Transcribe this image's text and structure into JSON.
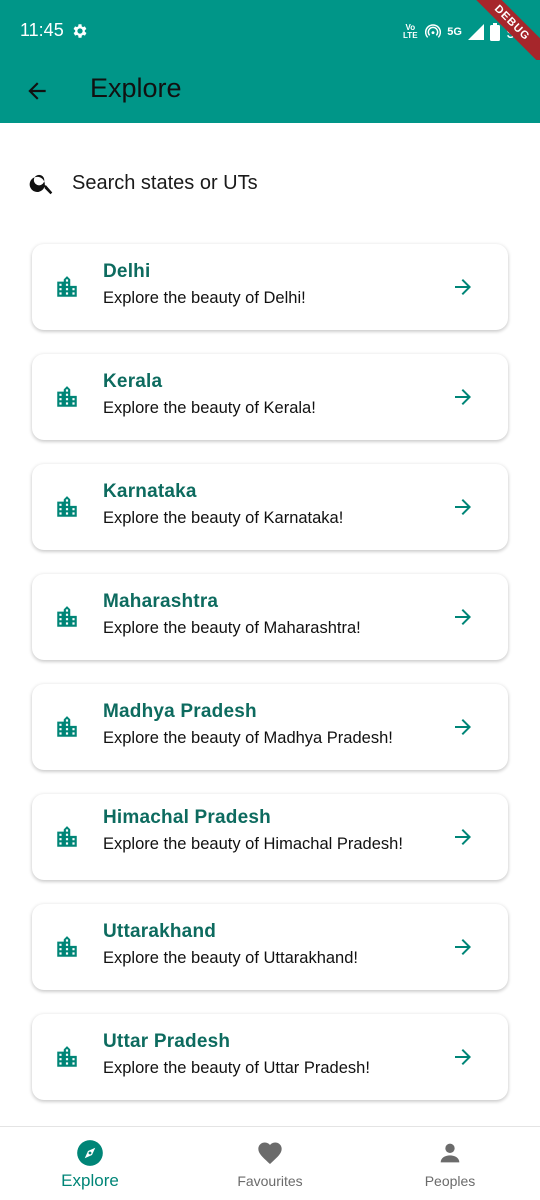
{
  "status_bar": {
    "time": "11:45",
    "network": "5G",
    "volte": "Vo LTE",
    "battery": "93"
  },
  "debug_banner": "DEBUG",
  "app_bar": {
    "title": "Explore"
  },
  "search": {
    "placeholder": "Search states or UTs"
  },
  "places": [
    {
      "name": "Delhi",
      "subtitle": "Explore the beauty of Delhi!"
    },
    {
      "name": "Kerala",
      "subtitle": "Explore the beauty of Kerala!"
    },
    {
      "name": "Karnataka",
      "subtitle": "Explore the beauty of Karnataka!"
    },
    {
      "name": "Maharashtra",
      "subtitle": "Explore the beauty of Maharashtra!"
    },
    {
      "name": "Madhya Pradesh",
      "subtitle": "Explore the beauty of Madhya Pradesh!"
    },
    {
      "name": "Himachal Pradesh",
      "subtitle": "Explore the beauty of Himachal Pradesh!"
    },
    {
      "name": "Uttarakhand",
      "subtitle": "Explore the beauty of Uttarakhand!"
    },
    {
      "name": "Uttar Pradesh",
      "subtitle": "Explore the beauty of Uttar Pradesh!"
    }
  ],
  "bottom_nav": [
    {
      "label": "Explore",
      "icon": "compass-icon",
      "active": true
    },
    {
      "label": "Favourites",
      "icon": "heart-icon",
      "active": false
    },
    {
      "label": "Peoples",
      "icon": "person-icon",
      "active": false
    }
  ],
  "colors": {
    "primary": "#009688",
    "title_text": "#0d6b5f",
    "active_nav": "#008577",
    "inactive_nav": "#6b6b6b",
    "debug": "#a6262b"
  }
}
